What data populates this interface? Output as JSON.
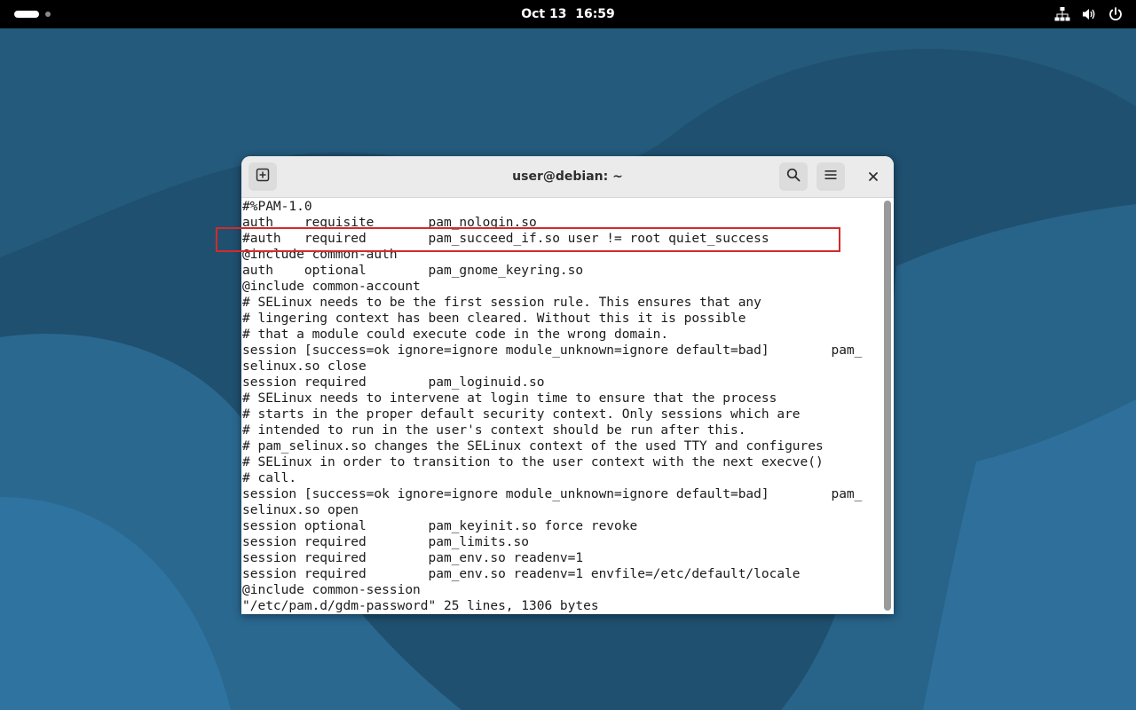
{
  "topbar": {
    "clock": "Oct 13  16:59",
    "icons": [
      "network-icon",
      "volume-icon",
      "power-icon"
    ]
  },
  "window": {
    "title": "user@debian: ~",
    "buttons": [
      "new-tab-icon",
      "search-icon",
      "menu-icon",
      "close-icon"
    ]
  },
  "terminal": {
    "lines": [
      "#%PAM-1.0",
      "auth    requisite       pam_nologin.so",
      "#auth   required        pam_succeed_if.so user != root quiet_success",
      "@include common-auth",
      "auth    optional        pam_gnome_keyring.so",
      "@include common-account",
      "# SELinux needs to be the first session rule. This ensures that any",
      "# lingering context has been cleared. Without this it is possible",
      "# that a module could execute code in the wrong domain.",
      "session [success=ok ignore=ignore module_unknown=ignore default=bad]        pam_",
      "selinux.so close",
      "session required        pam_loginuid.so",
      "# SELinux needs to intervene at login time to ensure that the process",
      "# starts in the proper default security context. Only sessions which are",
      "# intended to run in the user's context should be run after this.",
      "# pam_selinux.so changes the SELinux context of the used TTY and configures",
      "# SELinux in order to transition to the user context with the next execve()",
      "# call.",
      "session [success=ok ignore=ignore module_unknown=ignore default=bad]        pam_",
      "selinux.so open",
      "session optional        pam_keyinit.so force revoke",
      "session required        pam_limits.so",
      "session required        pam_env.so readenv=1",
      "session required        pam_env.so readenv=1 envfile=/etc/default/locale",
      "@include common-session",
      "\"/etc/pam.d/gdm-password\" 25 lines, 1306 bytes"
    ]
  },
  "colors": {
    "highlight": "#d42a2a",
    "wallpaper_dark": "#1b4a68",
    "wallpaper_light": "#2c6d95"
  }
}
